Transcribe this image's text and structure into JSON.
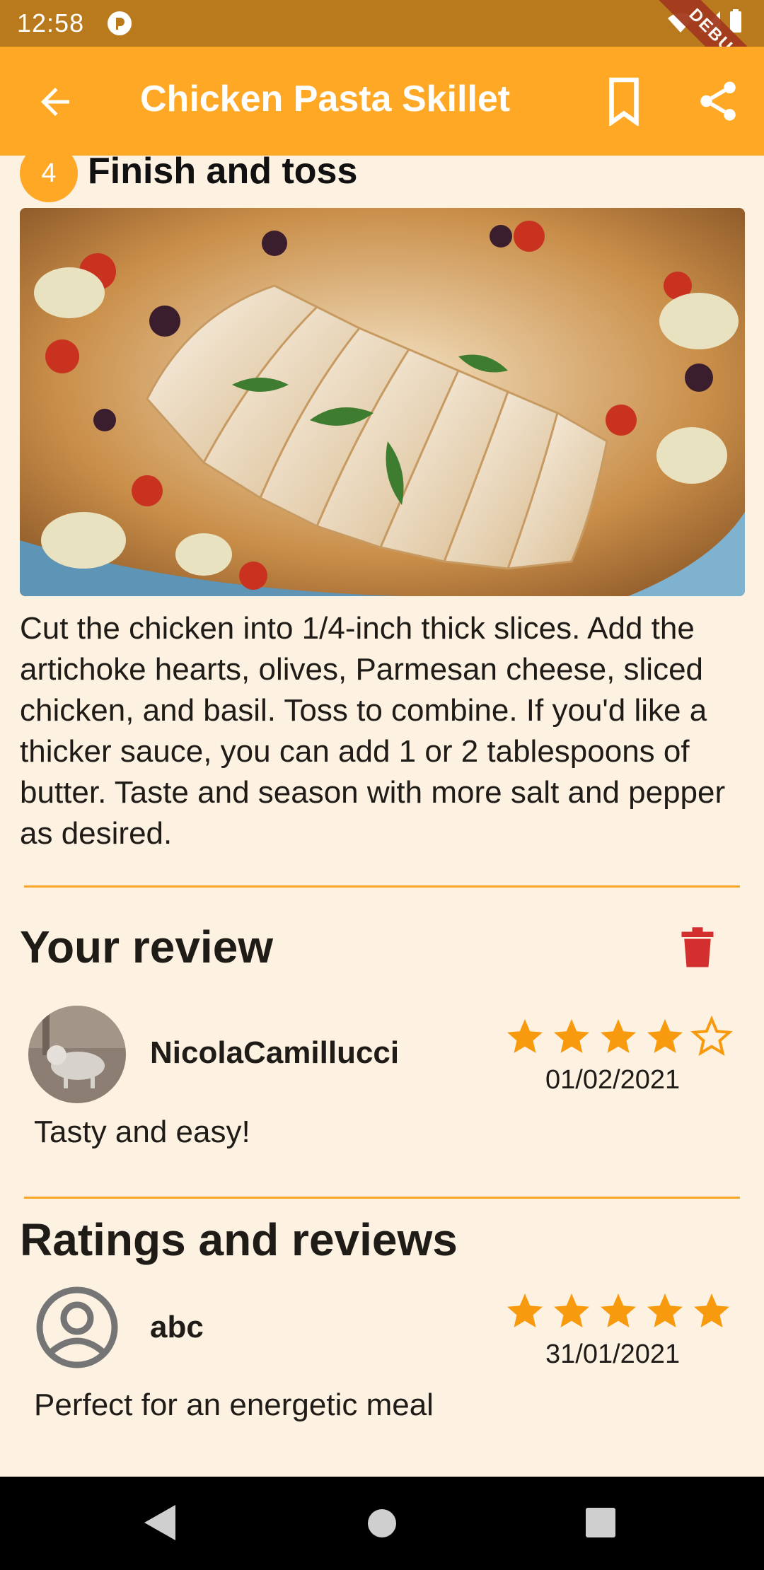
{
  "status_bar": {
    "time": "12:58",
    "debug_label": "DEBUG"
  },
  "app_bar": {
    "title": "Chicken Pasta Skillet"
  },
  "step": {
    "number": "4",
    "title": "Finish and toss",
    "text": "Cut the chicken into 1/4-inch thick slices. Add the artichoke hearts, olives, Parmesan cheese, sliced chicken, and basil. Toss to combine. If you'd like a thicker sauce, you can add 1 or 2 tablespoons of butter. Taste and season with more salt and pepper as desired."
  },
  "your_review": {
    "heading": "Your review",
    "user": "NicolaCamillucci",
    "rating": 4,
    "max_rating": 5,
    "date": "01/02/2021",
    "text": "Tasty and easy!"
  },
  "ratings_reviews": {
    "heading": "Ratings and reviews",
    "reviews": [
      {
        "user": "abc",
        "rating": 5,
        "date": "31/01/2021",
        "text": "Perfect for an energetic meal"
      }
    ]
  },
  "colors": {
    "accent": "#FFA826",
    "background": "#FDF1E1",
    "star": "#F79A0E",
    "delete": "#D32F2F"
  },
  "icons": [
    "back-arrow-icon",
    "bookmark-icon",
    "share-icon",
    "trash-icon",
    "star-icon",
    "person-icon"
  ]
}
